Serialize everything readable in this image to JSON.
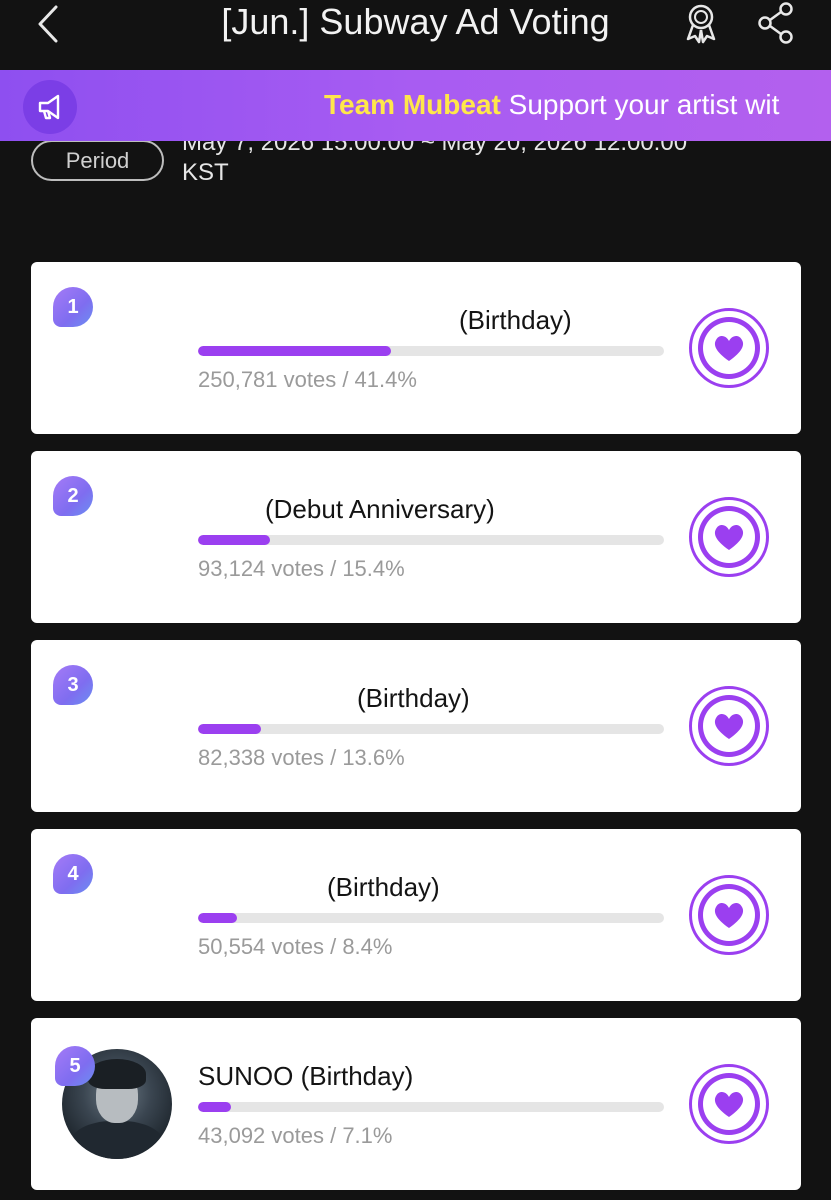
{
  "header": {
    "title": "[Jun.] Subway Ad Voting",
    "back_icon": "chevron-left-icon",
    "award_icon": "award-ribbon-icon",
    "share_icon": "share-icon"
  },
  "banner": {
    "icon": "megaphone-icon",
    "team": "Team Mubeat",
    "message": "Support your artist wit"
  },
  "period": {
    "label": "Period",
    "value": "May 7, 2026 15:00:00 ~ May 20, 2026 12:00:00 KST"
  },
  "colors": {
    "accent": "#9b3ff0",
    "banner_start": "#8e4ff0",
    "banner_end": "#b360ee",
    "team_highlight": "#ffe74a",
    "background": "#121212",
    "card": "#ffffff"
  },
  "candidates": [
    {
      "rank": "1",
      "name": "(Birthday)",
      "votes": "250,781 votes / 41.4%",
      "percent": 41.4
    },
    {
      "rank": "2",
      "name": "(Debut Anniversary)",
      "votes": "93,124 votes / 15.4%",
      "percent": 15.4
    },
    {
      "rank": "3",
      "name": "(Birthday)",
      "votes": "82,338 votes / 13.6%",
      "percent": 13.6
    },
    {
      "rank": "4",
      "name": "(Birthday)",
      "votes": "50,554 votes / 8.4%",
      "percent": 8.4
    },
    {
      "rank": "5",
      "name": "SUNOO (Birthday)",
      "votes": "43,092 votes / 7.1%",
      "percent": 7.1
    }
  ]
}
